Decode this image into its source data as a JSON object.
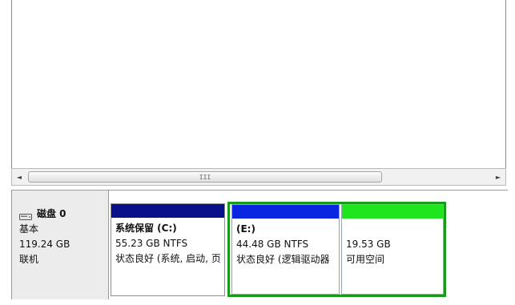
{
  "scrollbar": {
    "left_arrow": "◄",
    "right_arrow": "►",
    "grip": "III"
  },
  "disk": {
    "icon": "disk-drive-icon",
    "name": "磁盘 0",
    "type": "基本",
    "size": "119.24 GB",
    "status": "联机"
  },
  "partitions": [
    {
      "name": "系统保留  (C:)",
      "size": "55.23 GB NTFS",
      "status": "状态良好 (系统, 启动, 页",
      "color": "#08108a"
    },
    {
      "name": "(E:)",
      "size": "44.48 GB NTFS",
      "status": "状态良好 (逻辑驱动器",
      "color": "#0a26e0"
    },
    {
      "name": "",
      "size": "19.53 GB",
      "status": "可用空间",
      "color": "#1ee51e"
    }
  ],
  "extended_border_color": "#1a9a1a"
}
